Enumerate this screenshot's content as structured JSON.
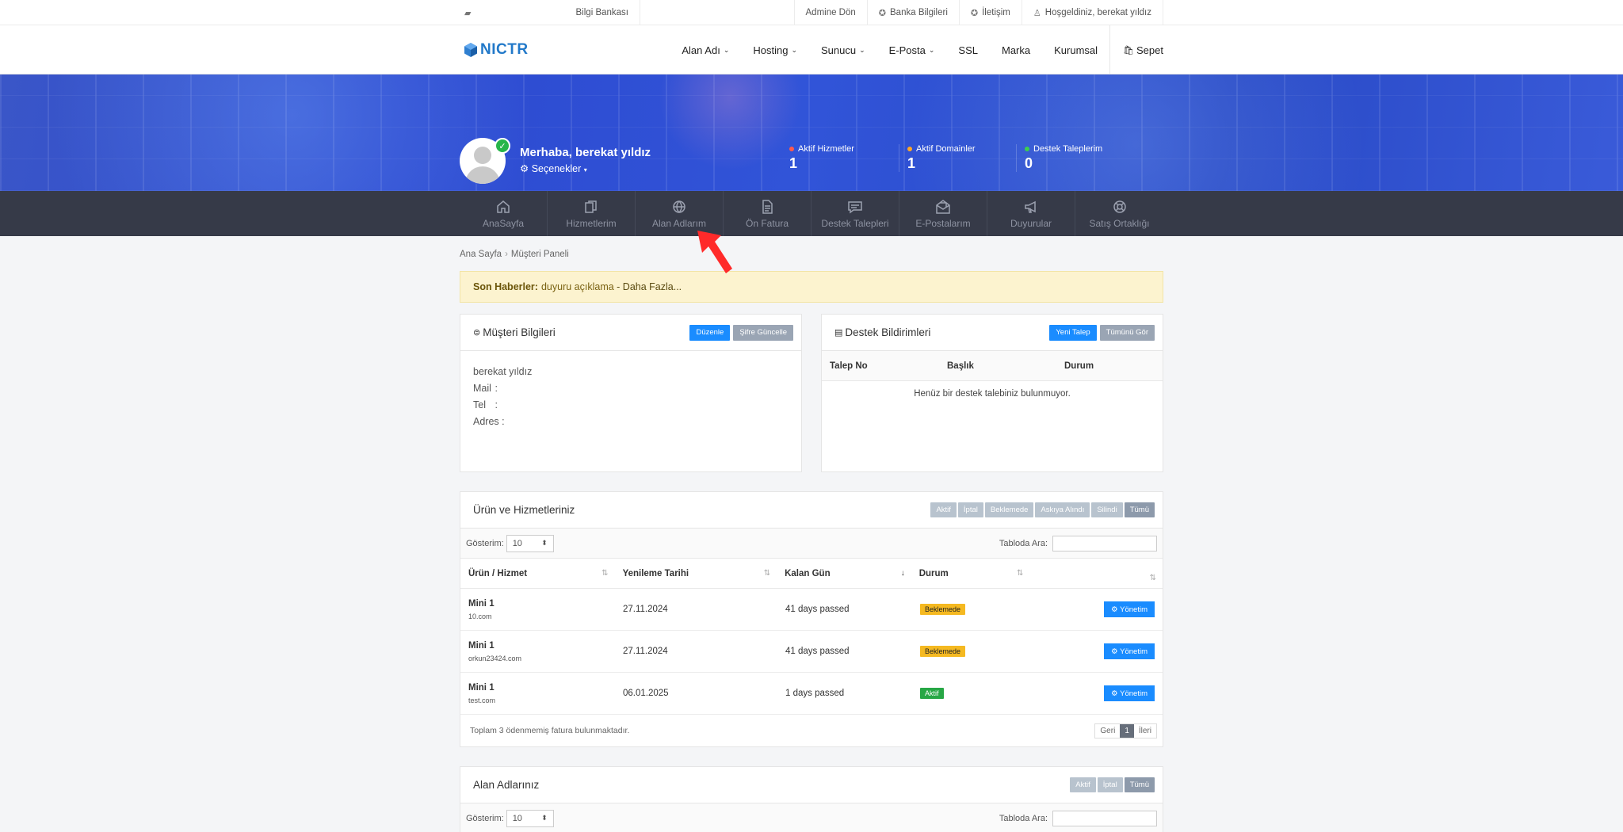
{
  "topbar": {
    "kb": "Bilgi Bankası",
    "admin": "Admine Dön",
    "bank": "Banka Bilgileri",
    "contact": "İletişim",
    "welcome": "Hoşgeldiniz, berekat yıldız"
  },
  "nav": {
    "logo": "NICTR",
    "links": [
      "Alan Adı",
      "Hosting",
      "Sunucu",
      "E-Posta",
      "SSL",
      "Marka",
      "Kurumsal"
    ],
    "cart": "Sepet"
  },
  "hero": {
    "greeting": "Merhaba, berekat yıldız",
    "options": "Seçenekler",
    "stats": [
      {
        "label": "Aktif Hizmetler",
        "value": "1",
        "color": "#ff5a4e"
      },
      {
        "label": "Aktif Domainler",
        "value": "1",
        "color": "#ffa726"
      },
      {
        "label": "Destek Taleplerim",
        "value": "0",
        "color": "#3ccf4e"
      }
    ]
  },
  "panelnav": [
    "AnaSayfa",
    "Hizmetlerim",
    "Alan Adlarım",
    "Ön Fatura",
    "Destek Talepleri",
    "E-Postalarım",
    "Duyurular",
    "Satış Ortaklığı"
  ],
  "breadcrumb": {
    "home": "Ana Sayfa",
    "current": "Müşteri Paneli"
  },
  "news": {
    "label": "Son Haberler:",
    "text": "duyuru açıklama",
    "more": "- Daha Fazla..."
  },
  "customer": {
    "title": "Müşteri Bilgileri",
    "edit": "Düzenle",
    "password": "Şifre Güncelle",
    "name": "berekat yıldız",
    "mail": "Mail",
    "tel": "Tel",
    "address": "Adres"
  },
  "support": {
    "title": "Destek Bildirimleri",
    "new": "Yeni Talep",
    "all": "Tümünü Gör",
    "cols": [
      "Talep No",
      "Başlık",
      "Durum"
    ],
    "empty": "Henüz bir destek talebiniz bulunmuyor."
  },
  "products": {
    "title": "Ürün ve Hizmetleriniz",
    "filters": [
      "Aktif",
      "İptal",
      "Beklemede",
      "Askıya Alındı",
      "Silindi",
      "Tümü"
    ],
    "show": "Gösterim:",
    "show_value": "10",
    "search": "Tabloda Ara:",
    "cols": [
      "Ürün / Hizmet",
      "Yenileme Tarihi",
      "Kalan Gün",
      "Durum"
    ],
    "rows": [
      {
        "name": "Mini 1",
        "domain": "10.com",
        "date": "27.11.2024",
        "days": "41 days passed",
        "status": "Beklemede"
      },
      {
        "name": "Mini 1",
        "domain": "orkun23424.com",
        "date": "27.11.2024",
        "days": "41 days passed",
        "status": "Beklemede"
      },
      {
        "name": "Mini 1",
        "domain": "test.com",
        "date": "06.01.2025",
        "days": "1 days passed",
        "status": "Aktif"
      }
    ],
    "manage": "Yönetim",
    "footer": "Toplam 3 ödenmemiş fatura bulunmaktadır.",
    "prev": "Geri",
    "page": "1",
    "next": "İleri"
  },
  "domains": {
    "title": "Alan Adlarınız",
    "filters": [
      "Aktif",
      "İptal",
      "Tümü"
    ],
    "show": "Gösterim:",
    "show_value": "10",
    "search": "Tabloda Ara:"
  }
}
